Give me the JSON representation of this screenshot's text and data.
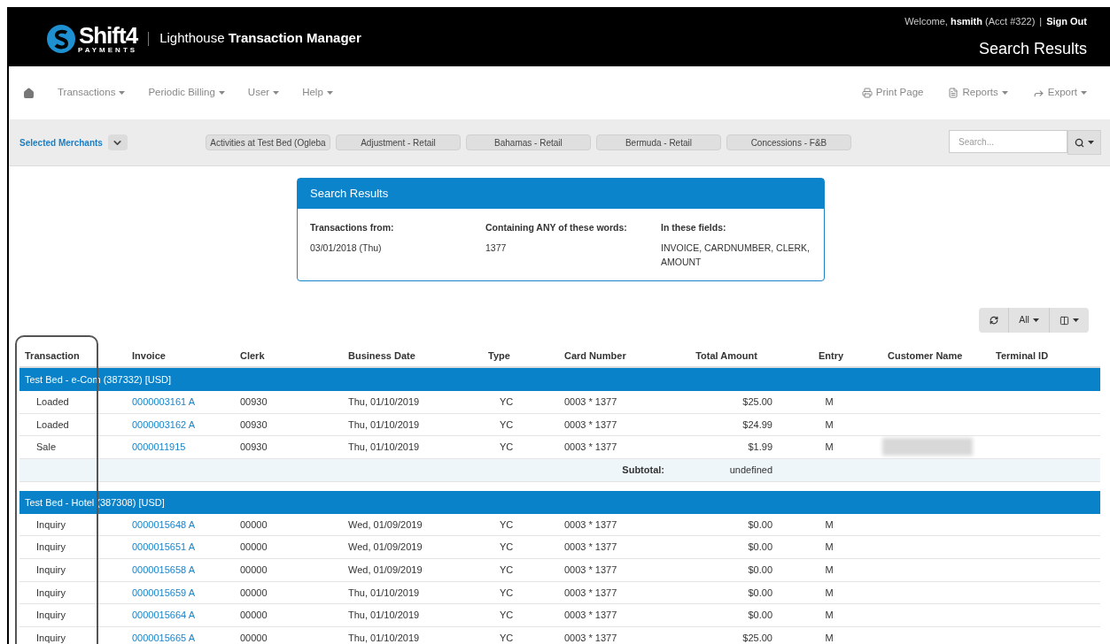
{
  "header": {
    "logo_wordmark": "Shift4",
    "logo_sub": "PAYMENTS",
    "app_title_light": "Lighthouse",
    "app_title_bold": "Transaction Manager",
    "welcome": "Welcome,",
    "username": "hsmith",
    "account": "(Acct #322)",
    "separator": "|",
    "sign_out": "Sign Out",
    "page_title": "Search Results"
  },
  "nav": {
    "left": [
      {
        "kind": "home"
      },
      {
        "kind": "menu",
        "label": "Transactions"
      },
      {
        "kind": "menu",
        "label": "Periodic Billing"
      },
      {
        "kind": "menu",
        "label": "User"
      },
      {
        "kind": "menu",
        "label": "Help"
      }
    ],
    "right": [
      {
        "kind": "print",
        "label": "Print Page",
        "dropdown": false
      },
      {
        "kind": "report",
        "label": "Reports",
        "dropdown": true
      },
      {
        "kind": "export",
        "label": "Export",
        "dropdown": true
      }
    ]
  },
  "merchants": {
    "label": "Selected Merchants",
    "chips": [
      "Activities at Test Bed (Ogleba",
      "Adjustment - Retail",
      "Bahamas - Retail",
      "Bermuda - Retail",
      "Concessions - F&B"
    ],
    "search_placeholder": "Search..."
  },
  "summary": {
    "title": "Search Results",
    "fields": [
      {
        "label": "Transactions from:",
        "value": "03/01/2018 (Thu)"
      },
      {
        "label": "Containing ANY of these words:",
        "value": "1377"
      },
      {
        "label": "In these fields:",
        "value": "INVOICE, CARDNUMBER, CLERK, AMOUNT"
      }
    ]
  },
  "toolbar": {
    "filter": "All"
  },
  "table": {
    "columns": [
      "Transaction",
      "Invoice",
      "Clerk",
      "Business Date",
      "Type",
      "Card Number",
      "Total Amount",
      "Entry",
      "Customer Name",
      "Terminal ID"
    ],
    "groups": [
      {
        "title": "Test Bed - e-Com (387332) [USD]",
        "rows": [
          {
            "transaction": "Loaded",
            "invoice": "0000003161 A",
            "clerk": "00930",
            "date": "Thu, 01/10/2019",
            "type": "YC",
            "card": "0003 * 1377",
            "amount": "$25.00",
            "entry": "M",
            "customer_blurred": false
          },
          {
            "transaction": "Loaded",
            "invoice": "0000003162 A",
            "clerk": "00930",
            "date": "Thu, 01/10/2019",
            "type": "YC",
            "card": "0003 * 1377",
            "amount": "$24.99",
            "entry": "M",
            "customer_blurred": false
          },
          {
            "transaction": "Sale",
            "invoice": "0000011915",
            "clerk": "00930",
            "date": "Thu, 01/10/2019",
            "type": "YC",
            "card": "0003 * 1377",
            "amount": "$1.99",
            "entry": "M",
            "customer_blurred": true
          }
        ],
        "subtotal": {
          "label": "Subtotal:",
          "value": "undefined"
        }
      },
      {
        "title": "Test Bed - Hotel (387308) [USD]",
        "rows": [
          {
            "transaction": "Inquiry",
            "invoice": "0000015648 A",
            "clerk": "00000",
            "date": "Wed, 01/09/2019",
            "type": "YC",
            "card": "0003 * 1377",
            "amount": "$0.00",
            "entry": "M",
            "customer_blurred": false
          },
          {
            "transaction": "Inquiry",
            "invoice": "0000015651 A",
            "clerk": "00000",
            "date": "Wed, 01/09/2019",
            "type": "YC",
            "card": "0003 * 1377",
            "amount": "$0.00",
            "entry": "M",
            "customer_blurred": false
          },
          {
            "transaction": "Inquiry",
            "invoice": "0000015658 A",
            "clerk": "00000",
            "date": "Wed, 01/09/2019",
            "type": "YC",
            "card": "0003 * 1377",
            "amount": "$0.00",
            "entry": "M",
            "customer_blurred": false
          },
          {
            "transaction": "Inquiry",
            "invoice": "0000015659 A",
            "clerk": "00000",
            "date": "Thu, 01/10/2019",
            "type": "YC",
            "card": "0003 * 1377",
            "amount": "$0.00",
            "entry": "M",
            "customer_blurred": false
          },
          {
            "transaction": "Inquiry",
            "invoice": "0000015664 A",
            "clerk": "00000",
            "date": "Thu, 01/10/2019",
            "type": "YC",
            "card": "0003 * 1377",
            "amount": "$0.00",
            "entry": "M",
            "customer_blurred": false
          },
          {
            "transaction": "Inquiry",
            "invoice": "0000015665 A",
            "clerk": "00000",
            "date": "Thu, 01/10/2019",
            "type": "YC",
            "card": "0003 * 1377",
            "amount": "$25.00",
            "entry": "M",
            "customer_blurred": false
          }
        ]
      }
    ]
  }
}
